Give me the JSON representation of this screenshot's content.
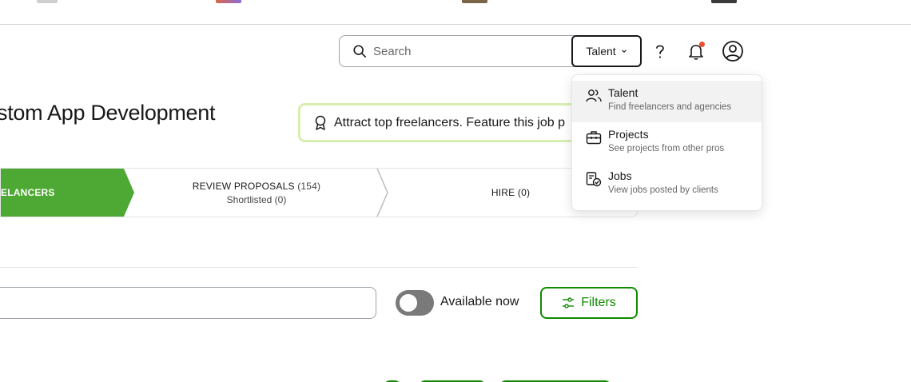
{
  "header": {
    "search_placeholder": "Search",
    "search_scope": "Talent",
    "help_icon": "question-mark-icon",
    "notifications_icon": "bell-icon",
    "profile_icon": "user-circle-icon"
  },
  "job": {
    "title": "stom App Development",
    "feature_banner": "Attract top freelancers. Feature this job p"
  },
  "steps": {
    "active_label": "ELANCERS",
    "review": {
      "label": "REVIEW PROPOSALS",
      "count": "(154)",
      "sub": "Shortlisted (0)"
    },
    "hire": {
      "label": "HIRE",
      "count": "(0)"
    }
  },
  "filters": {
    "toggle_label": "Available now",
    "toggle_on": false,
    "filters_label": "Filters"
  },
  "dropdown": {
    "items": [
      {
        "label": "Talent",
        "sub": "Find freelancers and agencies",
        "icon": "people-icon",
        "active": true
      },
      {
        "label": "Projects",
        "sub": "See projects from other pros",
        "icon": "briefcase-icon",
        "active": false
      },
      {
        "label": "Jobs",
        "sub": "View jobs posted by clients",
        "icon": "document-check-icon",
        "active": false
      }
    ]
  },
  "colors": {
    "brand_green": "#108a00",
    "active_step_green": "#4ea934",
    "banner_border": "#d8efb2",
    "notification_dot": "#e8502f"
  }
}
